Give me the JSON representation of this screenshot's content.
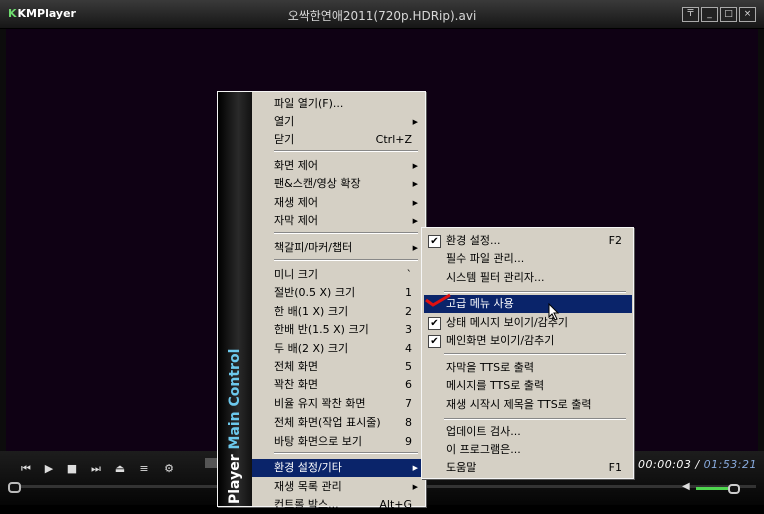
{
  "app": {
    "logo": "KMPlayer",
    "logo_glyph": "K",
    "title": "오싹한연애2011(720p.HDRip).avi"
  },
  "window_buttons": {
    "pin": "〒",
    "minimize": "_",
    "maximize": "□",
    "close": "×"
  },
  "controls": {
    "prev": "⏮",
    "play": "▶",
    "stop": "■",
    "next": "⏭",
    "eject": "⏏",
    "playlist": "≡",
    "settings": "⚙"
  },
  "time": {
    "current": "00:00:03",
    "separator": " / ",
    "total": "01:53:21"
  },
  "volume": {
    "icon": "◀",
    "level": 0.85
  },
  "main_menu": {
    "sidebar_prefix": "Player",
    "sidebar_title": "Main Control",
    "items": [
      {
        "label": "파일 열기(F)...",
        "shortcut": "",
        "arrow": ""
      },
      {
        "label": "열기",
        "shortcut": "",
        "arrow": "▶"
      },
      {
        "label": "닫기",
        "shortcut": "Ctrl+Z",
        "arrow": ""
      },
      {
        "label": "화면 제어",
        "shortcut": "",
        "arrow": "▶"
      },
      {
        "label": "팬&스캔/영상 확장",
        "shortcut": "",
        "arrow": "▶"
      },
      {
        "label": "재생 제어",
        "shortcut": "",
        "arrow": "▶"
      },
      {
        "label": "자막 제어",
        "shortcut": "",
        "arrow": "▶"
      },
      {
        "label": "책갈피/마커/챕터",
        "shortcut": "",
        "arrow": "▶"
      },
      {
        "label": "미니 크기",
        "shortcut": "`",
        "arrow": ""
      },
      {
        "label": "절반(0.5 X) 크기",
        "shortcut": "1",
        "arrow": ""
      },
      {
        "label": "한 배(1 X) 크기",
        "shortcut": "2",
        "arrow": ""
      },
      {
        "label": "한배 반(1.5 X) 크기",
        "shortcut": "3",
        "arrow": ""
      },
      {
        "label": "두 배(2 X) 크기",
        "shortcut": "4",
        "arrow": ""
      },
      {
        "label": "전체 화면",
        "shortcut": "5",
        "arrow": ""
      },
      {
        "label": "꽉찬 화면",
        "shortcut": "6",
        "arrow": ""
      },
      {
        "label": "비율 유지 꽉찬 화면",
        "shortcut": "7",
        "arrow": ""
      },
      {
        "label": "전체 화면(작업 표시줄)",
        "shortcut": "8",
        "arrow": ""
      },
      {
        "label": "바탕 화면으로 보기",
        "shortcut": "9",
        "arrow": ""
      },
      {
        "label": "환경 설정/기타",
        "shortcut": "",
        "arrow": "▶"
      },
      {
        "label": "재생 목록 관리",
        "shortcut": "",
        "arrow": "▶"
      },
      {
        "label": "컨트롤 박스...",
        "shortcut": "Alt+G",
        "arrow": ""
      }
    ]
  },
  "sub_menu": {
    "items": [
      {
        "label": "환경 설정...",
        "shortcut": "F2",
        "checked": "✔"
      },
      {
        "label": "필수 파일 관리...",
        "shortcut": "",
        "checked": ""
      },
      {
        "label": "시스템 필터 관리자...",
        "shortcut": "",
        "checked": ""
      },
      {
        "label": "고급 메뉴 사용",
        "shortcut": "",
        "checked": ""
      },
      {
        "label": "상태 메시지 보이기/감추기",
        "shortcut": "",
        "checked": "✔"
      },
      {
        "label": "메인화면 보이기/감추기",
        "shortcut": "",
        "checked": "✔"
      },
      {
        "label": "자막을 TTS로 출력",
        "shortcut": "",
        "checked": ""
      },
      {
        "label": "메시지를 TTS로 출력",
        "shortcut": "",
        "checked": ""
      },
      {
        "label": "재생 시작시 제목을 TTS로 출력",
        "shortcut": "",
        "checked": ""
      },
      {
        "label": "업데이트 검사...",
        "shortcut": "",
        "checked": ""
      },
      {
        "label": "이 프로그램은...",
        "shortcut": "",
        "checked": ""
      },
      {
        "label": "도움말",
        "shortcut": "F1",
        "checked": ""
      }
    ]
  },
  "colors": {
    "highlight": "#0a246a",
    "menu_bg": "#d5d0c5",
    "volume": "#4fd64f",
    "sidebar_accent": "#6cc8ec"
  }
}
